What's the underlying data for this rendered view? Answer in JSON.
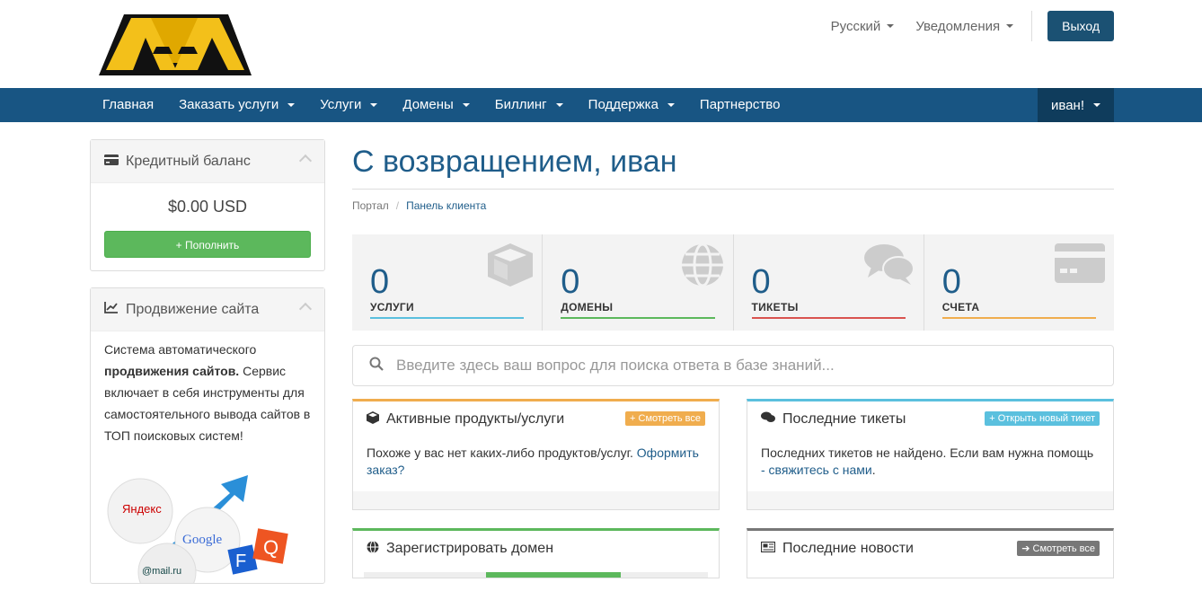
{
  "header": {
    "language": "Русский",
    "notifications": "Уведомления",
    "logout": "Выход"
  },
  "nav": {
    "items": [
      {
        "label": "Главная",
        "dropdown": false
      },
      {
        "label": "Заказать услуги",
        "dropdown": true
      },
      {
        "label": "Услуги",
        "dropdown": true
      },
      {
        "label": "Домены",
        "dropdown": true
      },
      {
        "label": "Биллинг",
        "dropdown": true
      },
      {
        "label": "Поддержка",
        "dropdown": true
      },
      {
        "label": "Партнерство",
        "dropdown": false
      }
    ],
    "user": "иван!"
  },
  "sidebar": {
    "credit": {
      "title": "Кредитный баланс",
      "amount": "$0.00 USD",
      "button": "Пополнить"
    },
    "promo": {
      "title": "Продвижение сайта",
      "text_before": "Система автоматического ",
      "text_bold": "продвижения сайтов.",
      "text_after": " Сервис включает в себя инструменты для самостоятельного вывода сайтов в ТОП поисковых систем!",
      "ball_labels": [
        "Яндекс",
        "Google",
        "@mail.ru"
      ]
    }
  },
  "main": {
    "title": "С возвращением, иван",
    "breadcrumb": {
      "home": "Портал",
      "current": "Панель клиента"
    },
    "tiles": [
      {
        "value": "0",
        "label": "УСЛУГИ",
        "color": "#5bc0de",
        "icon": "cube-icon"
      },
      {
        "value": "0",
        "label": "ДОМЕНЫ",
        "color": "#5cb85c",
        "icon": "globe-icon"
      },
      {
        "value": "0",
        "label": "ТИКЕТЫ",
        "color": "#d9534f",
        "icon": "comments-icon"
      },
      {
        "value": "0",
        "label": "СЧЕТА",
        "color": "#f0ad4e",
        "icon": "credit-card-icon"
      }
    ],
    "search_placeholder": "Введите здесь ваш вопрос для поиска ответа в базе знаний...",
    "cards": {
      "products": {
        "title": "Активные продукты/услуги",
        "button": "Смотреть все",
        "text": "Похоже у вас нет каких-либо продуктов/услуг. ",
        "link": "Оформить заказ?"
      },
      "tickets": {
        "title": "Последние тикеты",
        "button": "Открыть новый тикет",
        "text": "Последних тикетов не найдено. Если вам нужна помощь ",
        "link": "- свяжитесь с нами",
        "text_end": "."
      },
      "domain": {
        "title": "Зарегистрировать домен"
      },
      "news": {
        "title": "Последние новости",
        "button": "Смотреть все"
      }
    }
  },
  "colors": {
    "navbar": "#185583",
    "accent": "#1f5d8a",
    "green": "#5cb85c",
    "orange": "#f0ad4e",
    "blue": "#5bc0de",
    "gray": "#777777"
  }
}
